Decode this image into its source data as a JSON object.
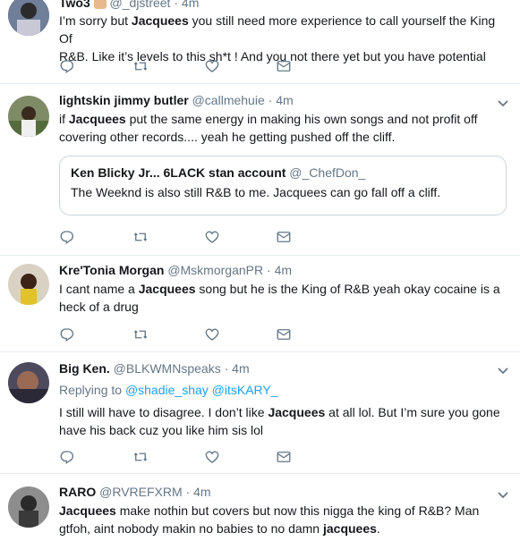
{
  "tweets": [
    {
      "name": "Two3",
      "handle": "@_djstreet",
      "sep": "·",
      "time": "4m",
      "text_segments": [
        {
          "t": "I’m sorry but "
        },
        {
          "t": "Jacquees",
          "b": true
        },
        {
          "t": " you still need more experience to call yourself the King Of"
        }
      ],
      "text_line2": "R&B. Like it’s levels to this sh*t ! And you not there yet but you have potential"
    },
    {
      "name": "lightskin jimmy butler",
      "handle": "@callmehuie",
      "sep": "·",
      "time": "4m",
      "line1_pre": "if ",
      "line1_bold": "Jacquees",
      "line1_post": " put the same energy in making his own songs and not profit off",
      "line2": "covering other records.... yeah he getting pushed off the cliff.",
      "quote": {
        "name": "Ken Blicky Jr... 6LACK stan account",
        "handle": "@_ChefDon_",
        "text": "The Weeknd is also still R&B to me. Jacquees can go fall off a cliff."
      }
    },
    {
      "name": "Kre'Tonia Morgan",
      "handle": "@MskmorganPR",
      "sep": "·",
      "time": "4m",
      "line1_pre": "I cant name a ",
      "line1_bold": "Jacquees",
      "line1_post": " song but he is the King of R&B yeah okay cocaine is a",
      "line2": "heck of a drug"
    },
    {
      "name": "Big Ken.",
      "handle": "@BLKWMNspeaks",
      "sep": "·",
      "time": "4m",
      "replying_label": "Replying to",
      "replying_1": "@shadie_shay",
      "replying_2": "@itsKARY_",
      "line1_pre": "I still will have to disagree. I don’t like ",
      "line1_bold": "Jacquees",
      "line1_post": " at all lol. But I’m sure you gone",
      "line2": "have his back cuz you like him sis lol"
    },
    {
      "name": "RARO",
      "handle": "@RVREFXRM",
      "sep": "·",
      "time": "4m",
      "line1_bold": "Jacquees",
      "line1_post": " make nothin but covers but now this nigga the king of R&B? Man",
      "line2_pre": "gtfoh, aint nobody makin no babies to no damn ",
      "line2_bold": "jacquees",
      "line2_post": "."
    }
  ],
  "icons": {
    "reply": "reply-icon",
    "retweet": "retweet-icon",
    "like": "heart-icon",
    "dm": "envelope-icon",
    "more": "chevron-down-icon"
  },
  "colors": {
    "text": "#14171a",
    "muted": "#657786",
    "link": "#1da1f2",
    "divider": "#e6ecf0"
  }
}
